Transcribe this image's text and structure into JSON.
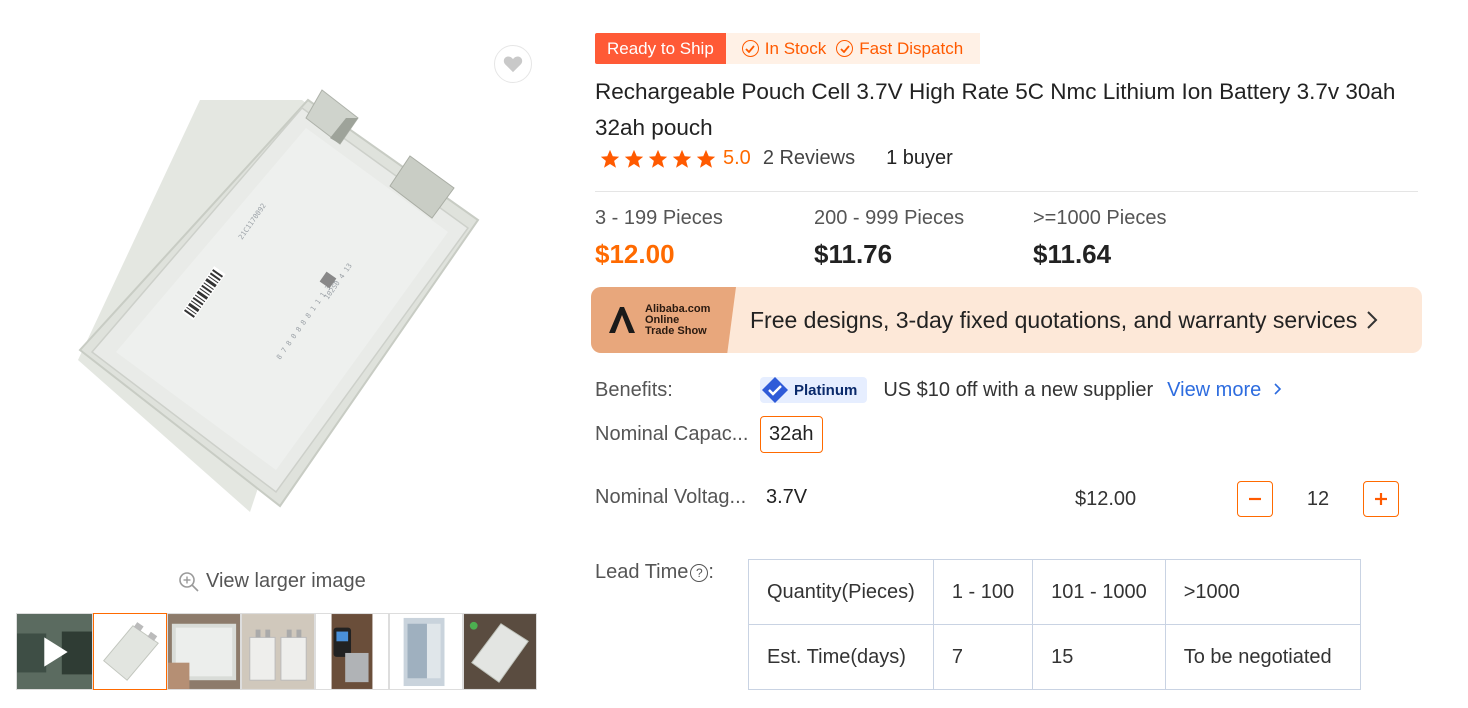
{
  "gallery": {
    "view_larger": "View larger image",
    "thumbnails": [
      "video",
      "battery-cell",
      "hand-cell",
      "two-cells",
      "device",
      "box",
      "cell-dark"
    ]
  },
  "badges": {
    "ready": "Ready to Ship",
    "in_stock": "In Stock",
    "fast_dispatch": "Fast Dispatch"
  },
  "product": {
    "title": "Rechargeable Pouch Cell 3.7V High Rate 5C Nmc Lithium Ion Battery 3.7v 30ah 32ah pouch",
    "rating": "5.0",
    "reviews": "2 Reviews",
    "buyers": "1 buyer",
    "rating_stars": 5
  },
  "tiers": [
    {
      "qty": "3 - 199 Pieces",
      "price": "$12.00"
    },
    {
      "qty": "200 - 999 Pieces",
      "price": "$11.76"
    },
    {
      "qty": ">=1000 Pieces",
      "price": "$11.64"
    }
  ],
  "tradeshow": {
    "logo_lines": [
      "Alibaba.com",
      "Online",
      "Trade Show"
    ],
    "text": "Free designs, 3-day fixed quotations, and warranty services"
  },
  "benefits": {
    "label": "Benefits:",
    "badge": "Platinum",
    "text": "US $10 off with a new supplier",
    "link": "View more"
  },
  "attributes": {
    "capacity_label": "Nominal Capac...",
    "capacity_option": "32ah",
    "voltage_label": "Nominal Voltag...",
    "voltage_value": "3.7V",
    "row_price": "$12.00",
    "quantity": "12"
  },
  "lead_time": {
    "label": "Lead Time",
    "rows": [
      [
        "Quantity(Pieces)",
        "1 - 100",
        "101 - 1000",
        ">1000"
      ],
      [
        "Est. Time(days)",
        "7",
        "15",
        "To be negotiated"
      ]
    ]
  },
  "colors": {
    "accent": "#ff6a00",
    "ready_badge": "#ff5a36",
    "link": "#2d6cdf"
  }
}
